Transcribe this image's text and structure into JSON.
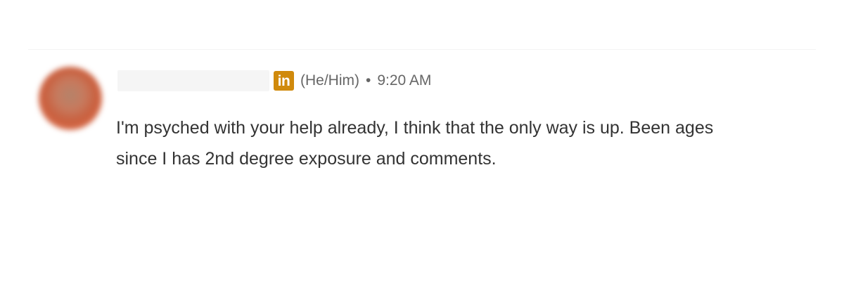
{
  "comment": {
    "author": {
      "name": "",
      "badge_text": "in",
      "badge_icon": "linkedin-icon",
      "badge_color": "#d08a0c",
      "pronouns": "(He/Him)"
    },
    "separator": "•",
    "timestamp": "9:20 AM",
    "text": "I'm psyched with your help already, I think that the only way is up. Been ages since I has 2nd degree exposure and comments."
  }
}
